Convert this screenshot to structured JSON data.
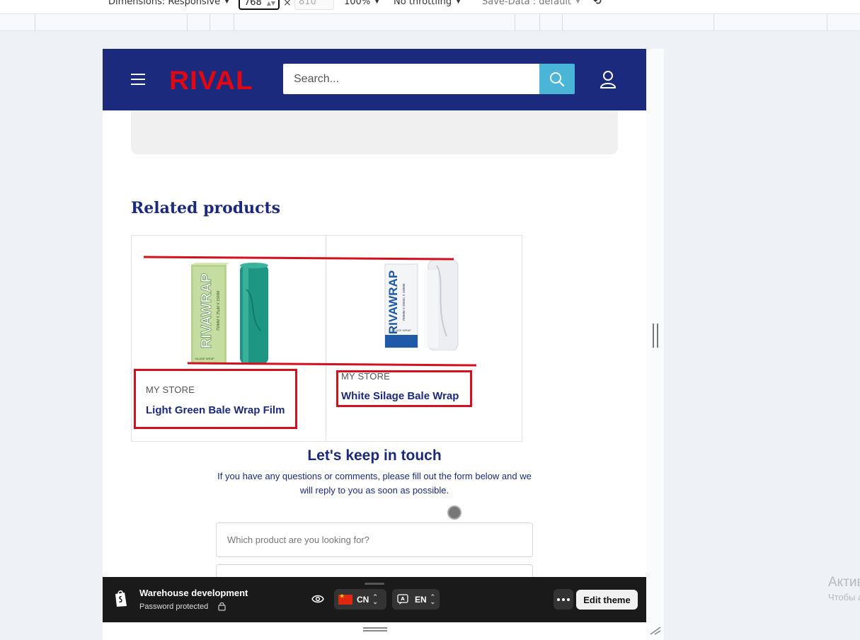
{
  "devtools": {
    "dimensions_label": "Dimensions: Responsive",
    "width_value": "768",
    "times": "×",
    "height_placeholder": "810",
    "zoom": "100%",
    "throttling": "No throttling",
    "save_data": "Save-Data : default"
  },
  "header": {
    "logo": "RIVAL",
    "search_placeholder": "Search..."
  },
  "related": {
    "title": "Related products",
    "products": [
      {
        "vendor": "MY STORE",
        "title": "Light Green Bale Wrap Film",
        "image_color": "#1f9e8a",
        "box_brand": "RIVAWRAP",
        "box_spec": "750MM X 25µM X 1500M",
        "box_sub": "SILAGE WRAP"
      },
      {
        "vendor": "MY STORE",
        "title": "White Silage Bale Wrap",
        "image_color": "#f3f4f6",
        "box_brand": "RIVAWRAP",
        "box_spec": "750MM X 25MIC X 1500M",
        "box_sub": "SILAGE WRAP"
      }
    ]
  },
  "contact": {
    "title": "Let's keep in touch",
    "subtitle": "If you have any questions or comments, please fill out the form below and we will reply to you as soon as possible.",
    "product_placeholder": "Which product are you looking for?"
  },
  "preview_bar": {
    "store_name": "Warehouse development",
    "status": "Password protected",
    "country": "CN",
    "language": "EN",
    "edit_label": "Edit theme"
  },
  "os_overlay": {
    "line1": "Активация Windows",
    "line2": "Чтобы активировать Windows, перейдите в раздел «Параметры»"
  },
  "colors": {
    "header_bg": "#1b2a7c",
    "brand_red": "#e30613",
    "search_button": "#4ab5d6",
    "annotation_red": "#d4101f",
    "preview_bar_bg": "#1a1a1a"
  }
}
